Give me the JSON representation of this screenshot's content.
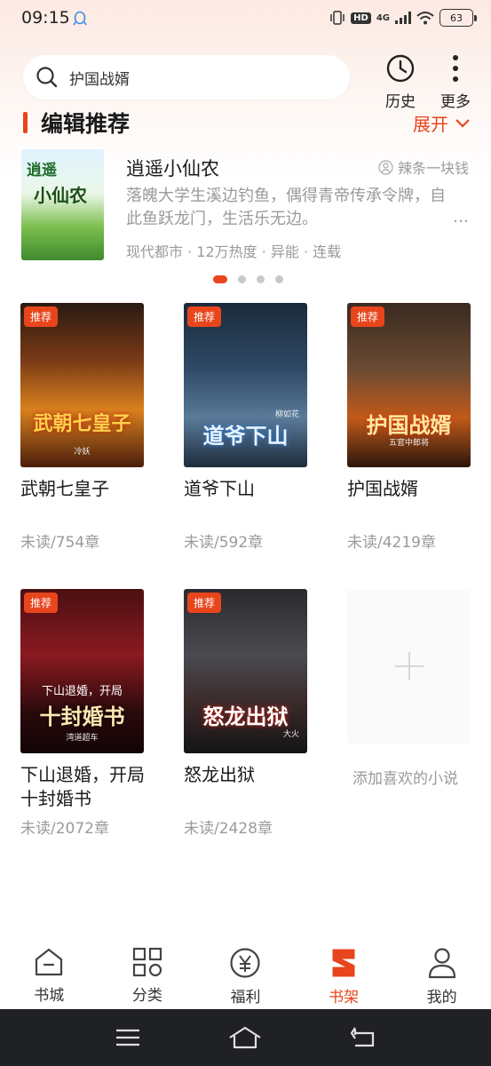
{
  "status_bar": {
    "time": "09:15",
    "hd": "HD",
    "network": "4G",
    "battery": "63"
  },
  "search": {
    "query": "护国战婿"
  },
  "top_actions": {
    "history_label": "历史",
    "more_label": "更多"
  },
  "editor_rec": {
    "title": "编辑推荐",
    "expand_label": "展开",
    "book": {
      "cover_text_1": "逍遥",
      "cover_text_2": "小仙农",
      "title": "逍遥小仙农",
      "author": "辣条一块钱",
      "description": "落魄大学生溪边钓鱼，偶得青帝传承令牌，自此鱼跃龙门，生活乐无边。",
      "meta": "现代都市 · 12万热度 · 异能 · 连载"
    },
    "pager": {
      "total": 4,
      "active": 0
    }
  },
  "shelf": {
    "badge_label": "推荐",
    "books": [
      {
        "title": "武朝七皇子",
        "progress": "未读/754章",
        "cover_title": "武朝七皇子",
        "cover_author": "冷妖",
        "recommended": true
      },
      {
        "title": "道爷下山",
        "progress": "未读/592章",
        "cover_title": "道爷下山",
        "cover_author": "柳如花",
        "recommended": true
      },
      {
        "title": "护国战婿",
        "progress": "未读/4219章",
        "cover_title": "护国战婿",
        "cover_author": "五官中郎将",
        "recommended": true
      },
      {
        "title": "下山退婚，开局十封婚书",
        "progress": "未读/2072章",
        "cover_title": "十封婚书",
        "cover_title_top": "下山退婚，开局",
        "cover_author": "湾道超车",
        "recommended": true
      },
      {
        "title": "怒龙出狱",
        "progress": "未读/2428章",
        "cover_title": "怒龙出狱",
        "cover_author": "大火",
        "recommended": true
      }
    ],
    "add_label": "添加喜欢的小说"
  },
  "bottom_nav": {
    "items": [
      {
        "label": "书城",
        "icon": "home-icon"
      },
      {
        "label": "分类",
        "icon": "category-icon"
      },
      {
        "label": "福利",
        "icon": "yuan-icon"
      },
      {
        "label": "书架",
        "icon": "bookshelf-icon",
        "active": true
      },
      {
        "label": "我的",
        "icon": "profile-icon"
      }
    ]
  },
  "colors": {
    "accent": "#e8451c",
    "muted_text": "#9a9a9a"
  }
}
